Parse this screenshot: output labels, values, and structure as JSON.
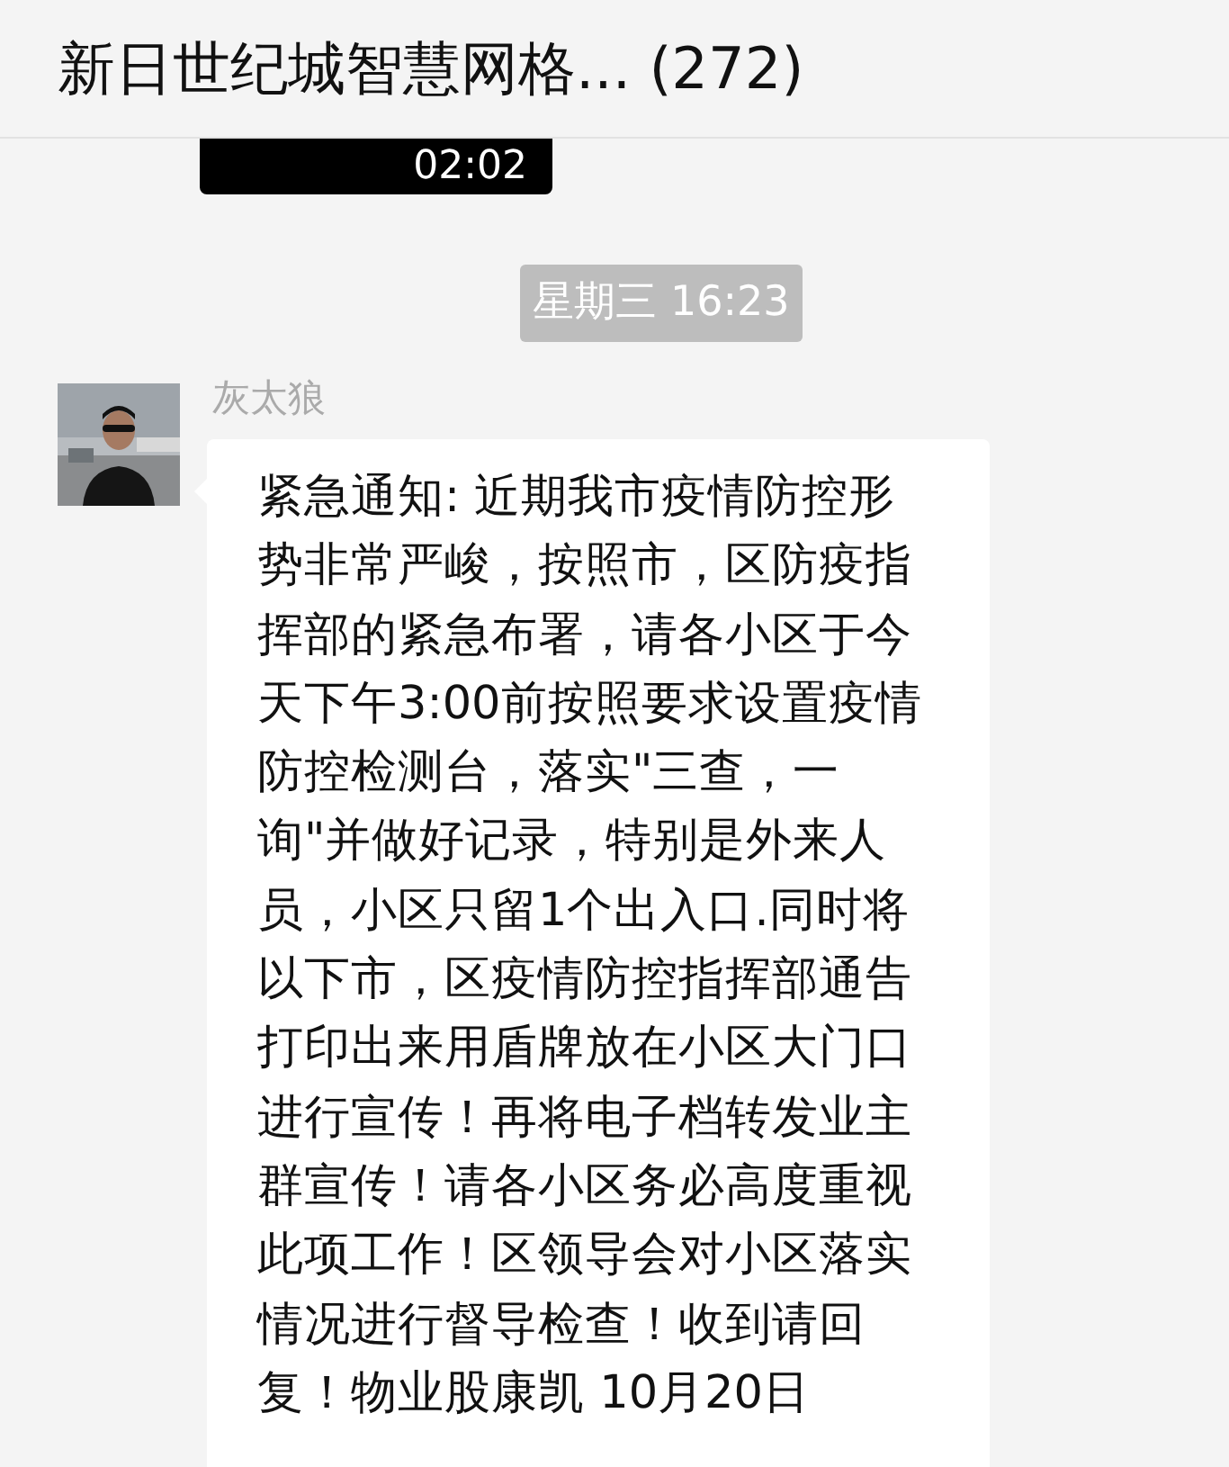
{
  "window": {
    "title": "新日世纪城智慧网格... (272)"
  },
  "messages": [
    {
      "kind": "video",
      "duration": "02:02"
    },
    {
      "kind": "time",
      "text": "星期三 16:23"
    },
    {
      "kind": "text",
      "sender": "灰太狼",
      "text": "紧急通知: 近期我市疫情防控形势非常严峻，按照市，区防疫指挥部的紧急布署，请各小区于今天下午3:00前按照要求设置疫情防控检测台，落实\"三查，一询\"并做好记录，特别是外来人员，小区只留1个出入口.同时将以下市，区疫情防控指挥部通告打印出来用盾牌放在小区大门口进行宣传！再将电子档转发业主群宣传！请各小区务必高度重视此项工作！区领导会对小区落实情况进行督导检查！收到请回复！物业股康凯 10月20日"
    }
  ]
}
